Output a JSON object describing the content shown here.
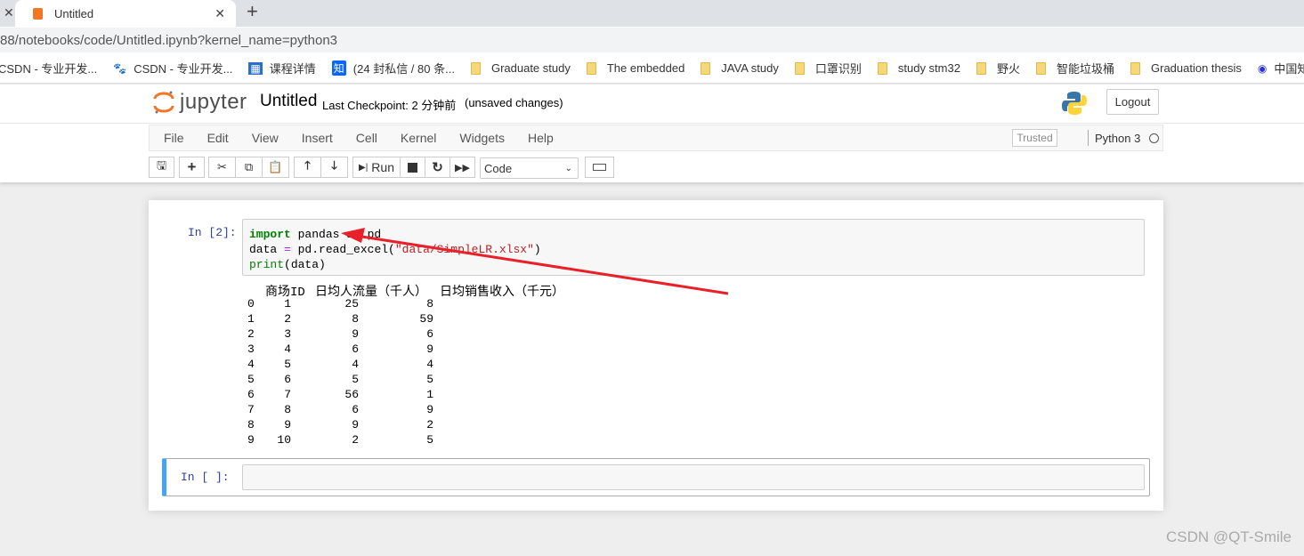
{
  "browser": {
    "tab_title": "Untitled",
    "url": "88/notebooks/code/Untitled.ipynb?kernel_name=python3",
    "bookmarks": [
      {
        "label": "CSDN - 专业开发...",
        "icon": "csdn-icon"
      },
      {
        "label": "CSDN - 专业开发...",
        "icon": "baidu-paw-icon"
      },
      {
        "label": "课程详情",
        "icon": "course-icon"
      },
      {
        "label": "(24 封私信 / 80 条...",
        "icon": "zhihu-icon"
      },
      {
        "label": "Graduate study",
        "icon": "folder-icon"
      },
      {
        "label": "The embedded",
        "icon": "folder-icon"
      },
      {
        "label": "JAVA study",
        "icon": "folder-icon"
      },
      {
        "label": "口罩识别",
        "icon": "folder-icon"
      },
      {
        "label": "study stm32",
        "icon": "folder-icon"
      },
      {
        "label": "野火",
        "icon": "folder-icon"
      },
      {
        "label": "智能垃圾桶",
        "icon": "folder-icon"
      },
      {
        "label": "Graduation thesis",
        "icon": "folder-icon"
      },
      {
        "label": "中国知网",
        "icon": "globe-icon"
      }
    ]
  },
  "jupyter": {
    "logo_text": "jupyter",
    "notebook_name": "Untitled",
    "checkpoint": "Last Checkpoint: 2 分钟前",
    "unsaved": "(unsaved changes)",
    "logout": "Logout",
    "menus": [
      "File",
      "Edit",
      "View",
      "Insert",
      "Cell",
      "Kernel",
      "Widgets",
      "Help"
    ],
    "trusted": "Trusted",
    "kernel": "Python 3",
    "run_label": "Run",
    "cell_type": "Code"
  },
  "cells": [
    {
      "prompt": "In  [2]:",
      "code": {
        "kw": "import",
        "l1": " pandas as pd",
        "l2a": "data ",
        "eq": "=",
        "l2b": " pd.read_excel(",
        "str": "\"data/SimpleLR.xlsx\"",
        "l2c": ")",
        "fn": "print",
        "l3": "(data)"
      },
      "output": {
        "headers": [
          "商场ID",
          "日均人流量（千人）",
          "日均销售收入（千元）"
        ],
        "rows": [
          [
            "0",
            "1",
            "25",
            "8"
          ],
          [
            "1",
            "2",
            "8",
            "59"
          ],
          [
            "2",
            "3",
            "9",
            "6"
          ],
          [
            "3",
            "4",
            "6",
            "9"
          ],
          [
            "4",
            "5",
            "4",
            "4"
          ],
          [
            "5",
            "6",
            "5",
            "5"
          ],
          [
            "6",
            "7",
            "56",
            "1"
          ],
          [
            "7",
            "8",
            "6",
            "9"
          ],
          [
            "8",
            "9",
            "9",
            "2"
          ],
          [
            "9",
            "10",
            "2",
            "5"
          ]
        ]
      }
    },
    {
      "prompt": "In  [ ]:"
    }
  ],
  "watermark": "CSDN @QT-Smile",
  "colors": {
    "accent_selected": "#42a5f5",
    "annotation_arrow": "#e8202a",
    "keyword": "#008000",
    "string": "#ba2121"
  }
}
